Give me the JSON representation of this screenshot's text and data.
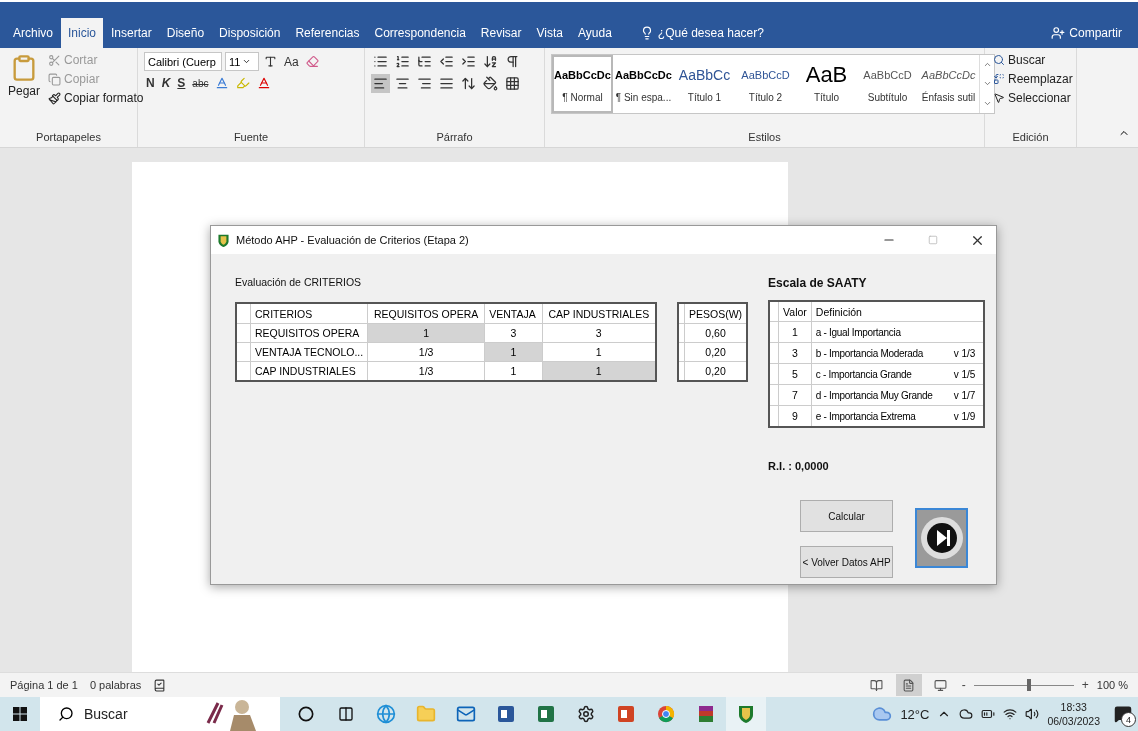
{
  "ribbon_tabs": [
    {
      "label": "Archivo",
      "selected": false
    },
    {
      "label": "Inicio",
      "selected": true
    },
    {
      "label": "Insertar",
      "selected": false
    },
    {
      "label": "Diseño",
      "selected": false
    },
    {
      "label": "Disposición",
      "selected": false
    },
    {
      "label": "Referencias",
      "selected": false
    },
    {
      "label": "Correspondencia",
      "selected": false
    },
    {
      "label": "Revisar",
      "selected": false
    },
    {
      "label": "Vista",
      "selected": false
    },
    {
      "label": "Ayuda",
      "selected": false
    }
  ],
  "tell_me": "¿Qué desea hacer?",
  "share": "Compartir",
  "clipboard": {
    "paste": "Pegar",
    "cut": "Cortar",
    "copy": "Copiar",
    "format_painter": "Copiar formato",
    "label": "Portapapeles"
  },
  "font": {
    "name": "Calibri (Cuerp",
    "size": "11",
    "case": "Aa",
    "bold": "N",
    "italic": "K",
    "underline": "S",
    "strike": "abc",
    "label": "Fuente"
  },
  "paragraph": {
    "label": "Párrafo"
  },
  "styles": {
    "label": "Estilos",
    "items": [
      {
        "preview": "AaBbCcDc",
        "name": "¶ Normal",
        "kind": "normal",
        "selected": true
      },
      {
        "preview": "AaBbCcDc",
        "name": "¶ Sin espa...",
        "kind": "bold",
        "selected": false
      },
      {
        "preview": "AaBbCc",
        "name": "Título 1",
        "kind": "heading1",
        "selected": false
      },
      {
        "preview": "AaBbCcD",
        "name": "Título 2",
        "kind": "heading2",
        "selected": false
      },
      {
        "preview": "AaB",
        "name": "Título",
        "kind": "title",
        "selected": false
      },
      {
        "preview": "AaBbCcD",
        "name": "Subtítulo",
        "kind": "subtitle",
        "selected": false
      },
      {
        "preview": "AaBbCcDc",
        "name": "Énfasis sutil",
        "kind": "emphasis",
        "selected": false
      }
    ]
  },
  "editing": {
    "find": "Buscar",
    "replace": "Reemplazar",
    "select": "Seleccionar",
    "label": "Edición"
  },
  "dialog": {
    "title": "Método AHP - Evaluación de Criterios (Etapa 2)",
    "criteria_label": "Evaluación de CRITERIOS",
    "columns": [
      "CRITERIOS",
      "REQUISITOS OPERA",
      "VENTAJA",
      "CAP INDUSTRIALES"
    ],
    "rows": [
      [
        {
          "value": "REQUISITOS OPERA",
          "shaded": false
        },
        {
          "value": "1",
          "shaded": true
        },
        {
          "value": "3",
          "shaded": false
        },
        {
          "value": "3",
          "shaded": false
        }
      ],
      [
        {
          "value": "VENTAJA TECNOLO...",
          "shaded": false
        },
        {
          "value": "1/3",
          "shaded": false
        },
        {
          "value": "1",
          "shaded": true
        },
        {
          "value": "1",
          "shaded": false
        }
      ],
      [
        {
          "value": "CAP INDUSTRIALES",
          "shaded": false
        },
        {
          "value": "1/3",
          "shaded": false
        },
        {
          "value": "1",
          "shaded": false
        },
        {
          "value": "1",
          "shaded": true
        }
      ]
    ],
    "weights_header": "PESOS(W)",
    "weights": [
      "0,60",
      "0,20",
      "0,20"
    ],
    "saaty_title": "Escala de SAATY",
    "saaty_columns": [
      "Valor",
      "Definición"
    ],
    "saaty_rows": [
      {
        "value": "1",
        "definition": "a - Igual Importancia"
      },
      {
        "value": "3",
        "definition": "b - Importancia Moderada",
        "reciprocal": "v  1/3"
      },
      {
        "value": "5",
        "definition": "c - Importancia Grande",
        "reciprocal": "v  1/5"
      },
      {
        "value": "7",
        "definition": "d - Importancia Muy Grande",
        "reciprocal": "v  1/7"
      },
      {
        "value": "9",
        "definition": "e - Importancia Extrema",
        "reciprocal": "v  1/9"
      }
    ],
    "ri": "R.I. : 0,0000",
    "calculate": "Calcular",
    "back": "< Volver Datos AHP"
  },
  "status_bar": {
    "page": "Página 1 de 1",
    "words": "0 palabras",
    "views": [
      {
        "kind": "read",
        "selected": false
      },
      {
        "kind": "print",
        "selected": true
      },
      {
        "kind": "web",
        "selected": false
      }
    ],
    "zoom_out": "-",
    "zoom_in": "+",
    "zoom_slider": {
      "level": 0.55
    },
    "zoom": "100 %"
  },
  "taskbar": {
    "search_placeholder": "Buscar",
    "apps": [
      {
        "kind": "cortana",
        "active": false
      },
      {
        "kind": "taskview",
        "active": false
      },
      {
        "kind": "edge",
        "active": false
      },
      {
        "kind": "explorer",
        "active": false
      },
      {
        "kind": "mail",
        "active": false
      },
      {
        "kind": "word",
        "active": false
      },
      {
        "kind": "excel",
        "active": false
      },
      {
        "kind": "settings",
        "active": false
      },
      {
        "kind": "powerpoint",
        "active": false
      },
      {
        "kind": "chrome",
        "active": false
      },
      {
        "kind": "archiver",
        "active": false
      },
      {
        "kind": "shield",
        "active": true
      }
    ],
    "weather": "12°C",
    "time": "18:33",
    "date": "06/03/2023",
    "notifications": "4"
  }
}
